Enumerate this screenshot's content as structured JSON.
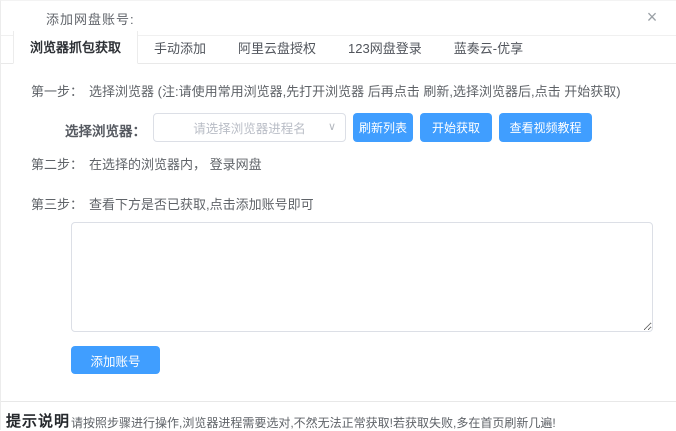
{
  "dialog": {
    "title": "添加网盘账号:",
    "close_icon": "×"
  },
  "tabs": [
    {
      "label": "浏览器抓包获取",
      "active": true
    },
    {
      "label": "手动添加",
      "active": false
    },
    {
      "label": "阿里云盘授权",
      "active": false
    },
    {
      "label": "123网盘登录",
      "active": false
    },
    {
      "label": "蓝奏云-优享",
      "active": false
    }
  ],
  "steps": {
    "step1_label": "第一步：",
    "step1_text": "选择浏览器 (注:请使用常用浏览器,先打开浏览器 后再点击 刷新,选择浏览器后,点击 开始获取)",
    "step2_label": "第二步：",
    "step2_text": "在选择的浏览器内， 登录网盘",
    "step3_label": "第三步：",
    "step3_text": "查看下方是否已获取,点击添加账号即可"
  },
  "browser_row": {
    "label": "选择浏览器：",
    "select_placeholder": "请选择浏览器进程名",
    "chevron_icon": "∨",
    "refresh_button": "刷新列表",
    "start_button": "开始获取",
    "video_button": "查看视频教程"
  },
  "result_box": {
    "value": ""
  },
  "add_account_button": "添加账号",
  "footer": {
    "label": "提示说明",
    "text": "请按照步骤进行操作,浏览器进程需要选对,不然无法正常获取!若获取失败,多在首页刷新几遍!"
  },
  "colors": {
    "primary": "#409EFF",
    "tab_border": "#e9e9e9",
    "input_border": "#dcdfe6"
  }
}
